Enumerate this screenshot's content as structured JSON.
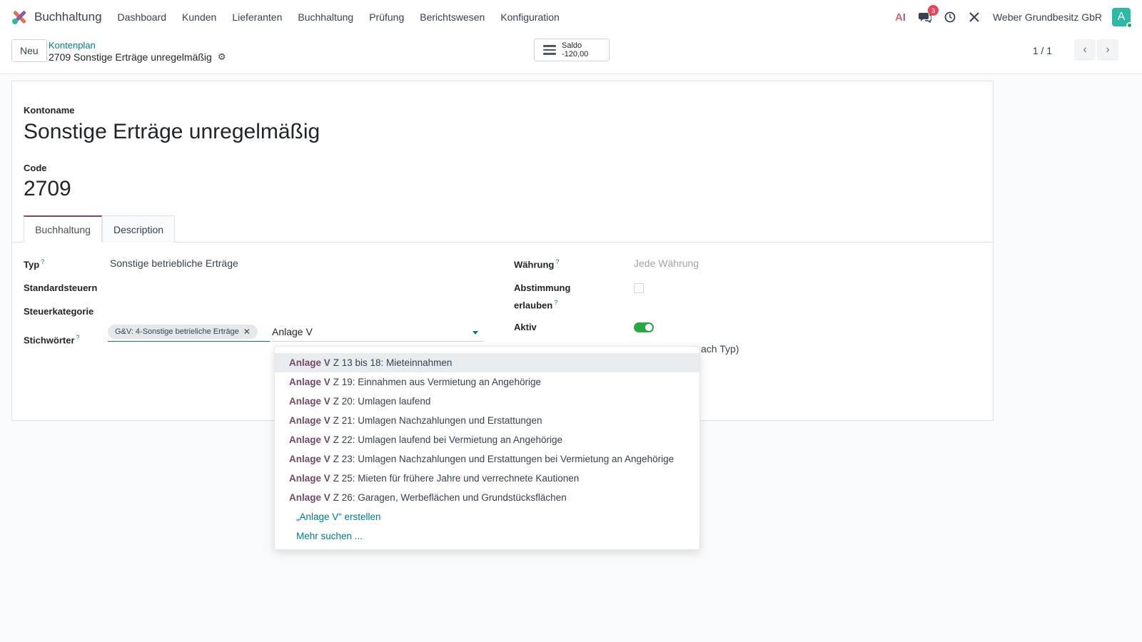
{
  "app": {
    "name": "Buchhaltung"
  },
  "nav": [
    "Dashboard",
    "Kunden",
    "Lieferanten",
    "Buchhaltung",
    "Prüfung",
    "Berichtswesen",
    "Konfiguration"
  ],
  "topbar": {
    "ai_icon": "AI",
    "chat_count": "3",
    "company": "Weber Grundbesitz GbR",
    "avatar_letter": "A"
  },
  "control": {
    "new_label": "Neu",
    "breadcrumb": "Kontenplan",
    "record_title": "2709 Sonstige Erträge unregelmäßig",
    "saldo_label": "Saldo",
    "saldo_value": "-120,00",
    "pager": "1 / 1"
  },
  "form": {
    "kontoname_label": "Kontoname",
    "kontoname": "Sonstige Erträge unregelmäßig",
    "code_label": "Code",
    "code": "2709",
    "tabs": [
      "Buchhaltung",
      "Description"
    ],
    "typ_label": "Typ",
    "typ": "Sonstige betriebliche Erträge",
    "standardsteuern_label": "Standardsteuern",
    "steuerkategorie_label": "Steuerkategorie",
    "stichwoerter_label": "Stichwörter",
    "tag": "G&V: 4-Sonstige betrieliche Erträge",
    "tag_input": "Anlage V",
    "waehrung_label": "Währung",
    "waehrung_placeholder": "Jede Währung",
    "abstimmung_label_1": "Abstimmung",
    "abstimmung_label_2": "erlauben",
    "aktiv_label": "Aktiv",
    "partial_text": "ach Typ)",
    "help_mark": "?"
  },
  "dropdown": {
    "match": "Anlage V",
    "items": [
      "Z 13 bis 18: Mieteinnahmen",
      "Z 19: Einnahmen aus Vermietung an Angehörige",
      "Z 20: Umlagen laufend",
      "Z 21: Umlagen Nachzahlungen und Erstattungen",
      "Z 22: Umlagen laufend bei Vermietung an Angehörige",
      "Z 23: Umlagen Nachzahlungen und Erstattungen bei Vermietung an Angehörige",
      "Z 25: Mieten für frühere Jahre und verrechnete Kautionen",
      "Z 26: Garagen, Werbeflächen und Grundstücksflächen"
    ],
    "create": "„Anlage V“ erstellen",
    "search_more": "Mehr suchen ..."
  },
  "colors": {
    "brand": "#714b67",
    "accent": "#017e84",
    "toggle_on": "#28a745",
    "badge": "#e2485a"
  }
}
